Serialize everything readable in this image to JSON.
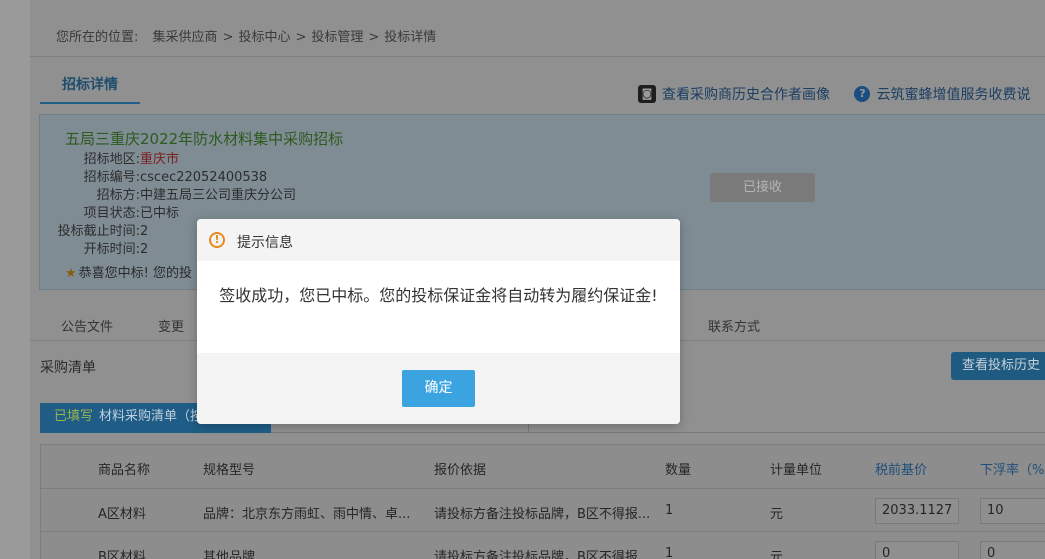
{
  "breadcrumb": {
    "prefix": "您所在的位置:",
    "items": [
      "集采供应商",
      "投标中心",
      "投标管理",
      "投标详情"
    ],
    "separator": ">"
  },
  "main_tab": "招标详情",
  "top_links": {
    "history": "查看采购商历史合作者画像",
    "service": "云筑蜜蜂增值服务收费说"
  },
  "project": {
    "title": "五局三重庆2022年防水材料集中采购招标",
    "fields": [
      {
        "label": "招标地区:",
        "value": "重庆市"
      },
      {
        "label": "招标编号:",
        "value": "cscec22052400538"
      },
      {
        "label": "招标方:",
        "value": "中建五局三公司重庆分公司"
      },
      {
        "label": "项目状态:",
        "value": "已中标"
      },
      {
        "label": "投标截止时间:",
        "value": "2"
      },
      {
        "label": "开标时间:",
        "value": "2"
      }
    ],
    "accepted_button": "已接收",
    "congrats": "恭喜您中标! 您的投"
  },
  "subtabs": [
    "公告文件",
    "变更",
    "联系方式"
  ],
  "section": {
    "title": "采购清单",
    "history_button": "查看投标历史"
  },
  "list_tab": {
    "done_label": "已填写",
    "label": "材料采购清单（按"
  },
  "table": {
    "headers": [
      "商品名称",
      "规格型号",
      "报价依据",
      "数量",
      "计量单位",
      "税前基价",
      "下浮率（%）"
    ],
    "rows": [
      {
        "name": "A区材料",
        "spec": "品牌：北京东方雨虹、雨中情、卓...",
        "basis": "请投标方备注投标品牌，B区不得报...",
        "qty": "1",
        "unit": "元",
        "base_price": "2033.1127",
        "rate": "10"
      },
      {
        "name": "B区材料",
        "spec": "其他品牌",
        "basis": "请投标方备注投标品牌，B区不得报...",
        "qty": "1",
        "unit": "元",
        "base_price": "0",
        "rate": "0"
      }
    ]
  },
  "dialog": {
    "title": "提示信息",
    "message": "签收成功，您已中标。您的投标保证金将自动转为履约保证金!",
    "ok_button": "确定",
    "icon": "warning-icon",
    "colors": {
      "accent": "#3aa3e0",
      "warning": "#e58a1e"
    }
  }
}
